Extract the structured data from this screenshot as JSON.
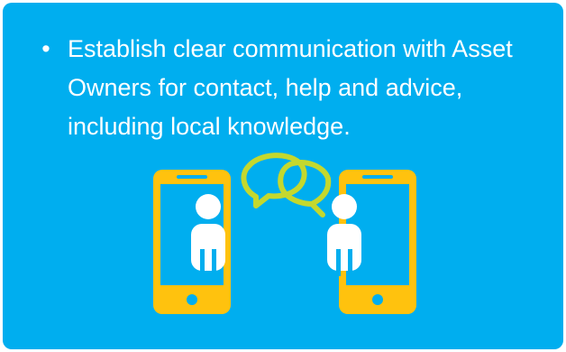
{
  "slide": {
    "bullets": [
      {
        "text": "Establish clear communication with Asset Owners for contact, help and advice, including local knowledge."
      }
    ]
  },
  "colors": {
    "background": "#00aeef",
    "phone_frame": "#ffc20e",
    "speech_bubbles": "#c4d82e",
    "person": "#ffffff"
  },
  "icons": {
    "illustration": "two-phones-chatting-icon"
  }
}
